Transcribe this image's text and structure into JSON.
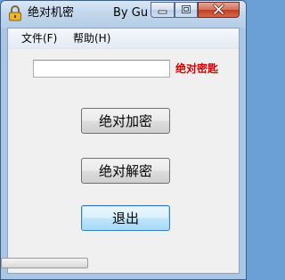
{
  "window": {
    "title": "绝对机密",
    "title_suffix": "By Gu"
  },
  "titlebar_icons": {
    "app": "padlock-icon",
    "minimize": "minimize-icon",
    "maximize": "maximize-icon",
    "close": "close-icon"
  },
  "menu": {
    "file": "文件(F)",
    "help": "帮助(H)"
  },
  "key": {
    "value": "",
    "label": "绝对密匙"
  },
  "buttons": {
    "encrypt": "绝对加密",
    "decrypt": "绝对解密",
    "exit": "退出"
  },
  "colors": {
    "key_label": "#d40000",
    "close_button": "#c13d21",
    "focus_border": "#3c7fb1"
  }
}
